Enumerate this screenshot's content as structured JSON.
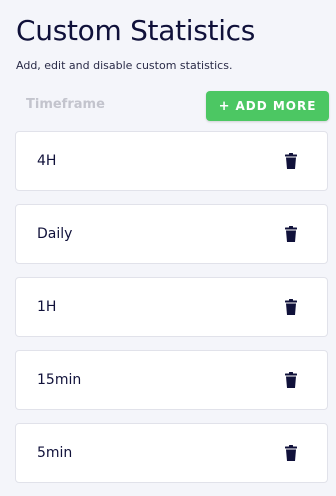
{
  "header": {
    "title": "Custom Statistics",
    "subtitle": "Add, edit and disable custom statistics."
  },
  "table": {
    "column_header": "Timeframe",
    "add_button": {
      "plus": "+",
      "label": "ADD MORE"
    },
    "rows": [
      {
        "label": "4H",
        "action_icon": "trash-icon"
      },
      {
        "label": "Daily",
        "action_icon": "trash-icon"
      },
      {
        "label": "1H",
        "action_icon": "trash-icon"
      },
      {
        "label": "15min",
        "action_icon": "trash-icon"
      },
      {
        "label": "5min",
        "action_icon": "trash-icon"
      }
    ]
  },
  "colors": {
    "background": "#f4f5fa",
    "text": "#10113a",
    "accent_green": "#4cc763",
    "muted_header": "#c3c4cd",
    "row_border": "#e1e2ea"
  }
}
